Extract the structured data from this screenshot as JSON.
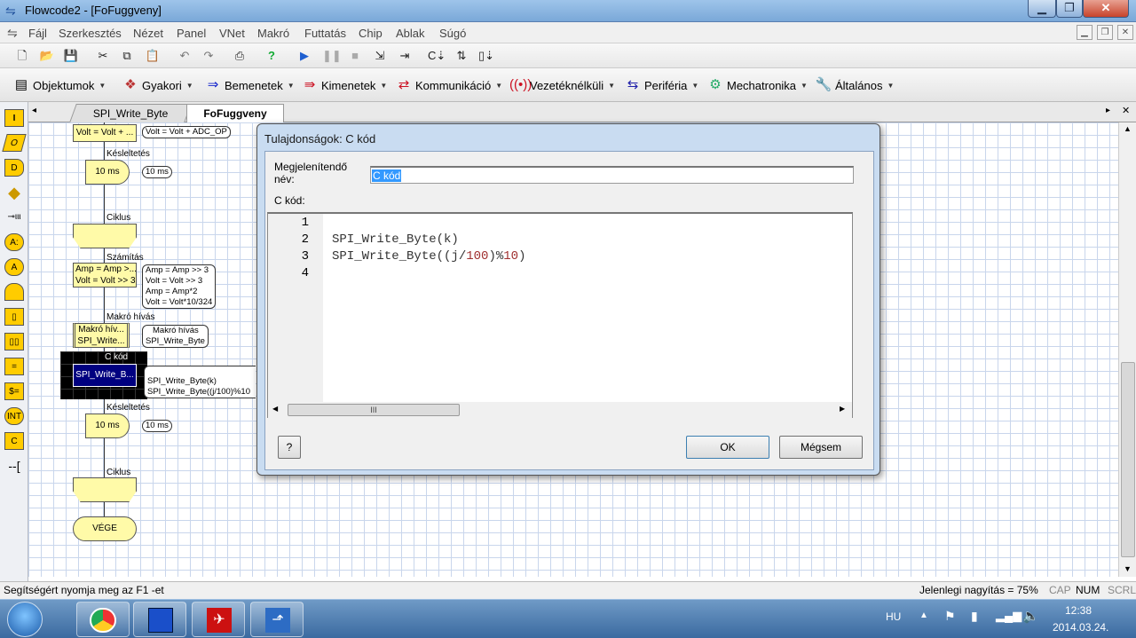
{
  "window": {
    "title": "Flowcode2 - [FoFuggveny]"
  },
  "menu": [
    "Fájl",
    "Szerkesztés",
    "Nézet",
    "Panel",
    "VNet",
    "Makró",
    "Futtatás",
    "Chip",
    "Ablak",
    "Súgó"
  ],
  "categories": [
    "Objektumok",
    "Gyakori",
    "Bemenetek",
    "Kimenetek",
    "Kommunikáció",
    "Vezetéknélküli",
    "Periféria",
    "Mechatronika",
    "Általános"
  ],
  "tabs": [
    "SPI_Write_Byte",
    "FoFuggveny"
  ],
  "flow": {
    "calc1": "Volt = Volt + ...",
    "calc1_cmt": "Volt = Volt + ADC_OP",
    "delay_caption": "Késleltetés",
    "delay_value": "10 ms",
    "delay_cmt": "10 ms",
    "loop_caption": "Ciklus",
    "calc_caption": "Számítás",
    "calc2_line1": "Amp = Amp >...",
    "calc2_line2": "Volt = Volt >> 3",
    "calc2_cmt": [
      "Amp = Amp >> 3",
      "Volt = Volt >> 3",
      "Amp = Amp*2",
      "Volt = Volt*10/324"
    ],
    "macro_caption": "Makró hívás",
    "macro_line1": "Makró hív...",
    "macro_line2": "SPI_Write...",
    "macro_cmt": [
      "Makró hívás",
      "SPI_Write_Byte"
    ],
    "ccode_caption": "C kód",
    "ccode_box": "SPI_Write_B...",
    "ccode_cmt": [
      "SPI_Write_Byte(k)",
      "SPI_Write_Byte((j/100)%10"
    ],
    "delay2_caption": "Késleltetés",
    "delay2_value": "10 ms",
    "delay2_cmt": "10 ms",
    "loop2_caption": "Ciklus",
    "end": "VÉGE"
  },
  "dialog": {
    "title": "Tulajdonságok: C kód",
    "name_label_1": "Megjelenítendő",
    "name_label_2": "név:",
    "name_value": "C kód",
    "code_label": "C kód:",
    "line_numbers": [
      "1",
      "2",
      "3",
      "4"
    ],
    "code_line2": "SPI_Write_Byte(k)",
    "code_line3_a": "SPI_Write_Byte((j/",
    "code_line3_b": "100",
    "code_line3_c": ")%",
    "code_line3_d": "10",
    "code_line3_e": ")",
    "help_btn": "?",
    "ok_btn": "OK",
    "cancel_btn": "Mégsem",
    "hscroll_grip": "III"
  },
  "status": {
    "help": "Segítségért nyomja meg az F1 -et",
    "zoom": "Jelenlegi nagyítás = 75%",
    "cap": "CAP",
    "num": "NUM",
    "scrl": "SCRL"
  },
  "taskbar": {
    "lang": "HU",
    "time": "12:38",
    "date": "2014.03.24."
  },
  "colors": {
    "accent": "#3399ff",
    "flow_fill": "#fffaa8",
    "selected_fill": "#000080"
  }
}
